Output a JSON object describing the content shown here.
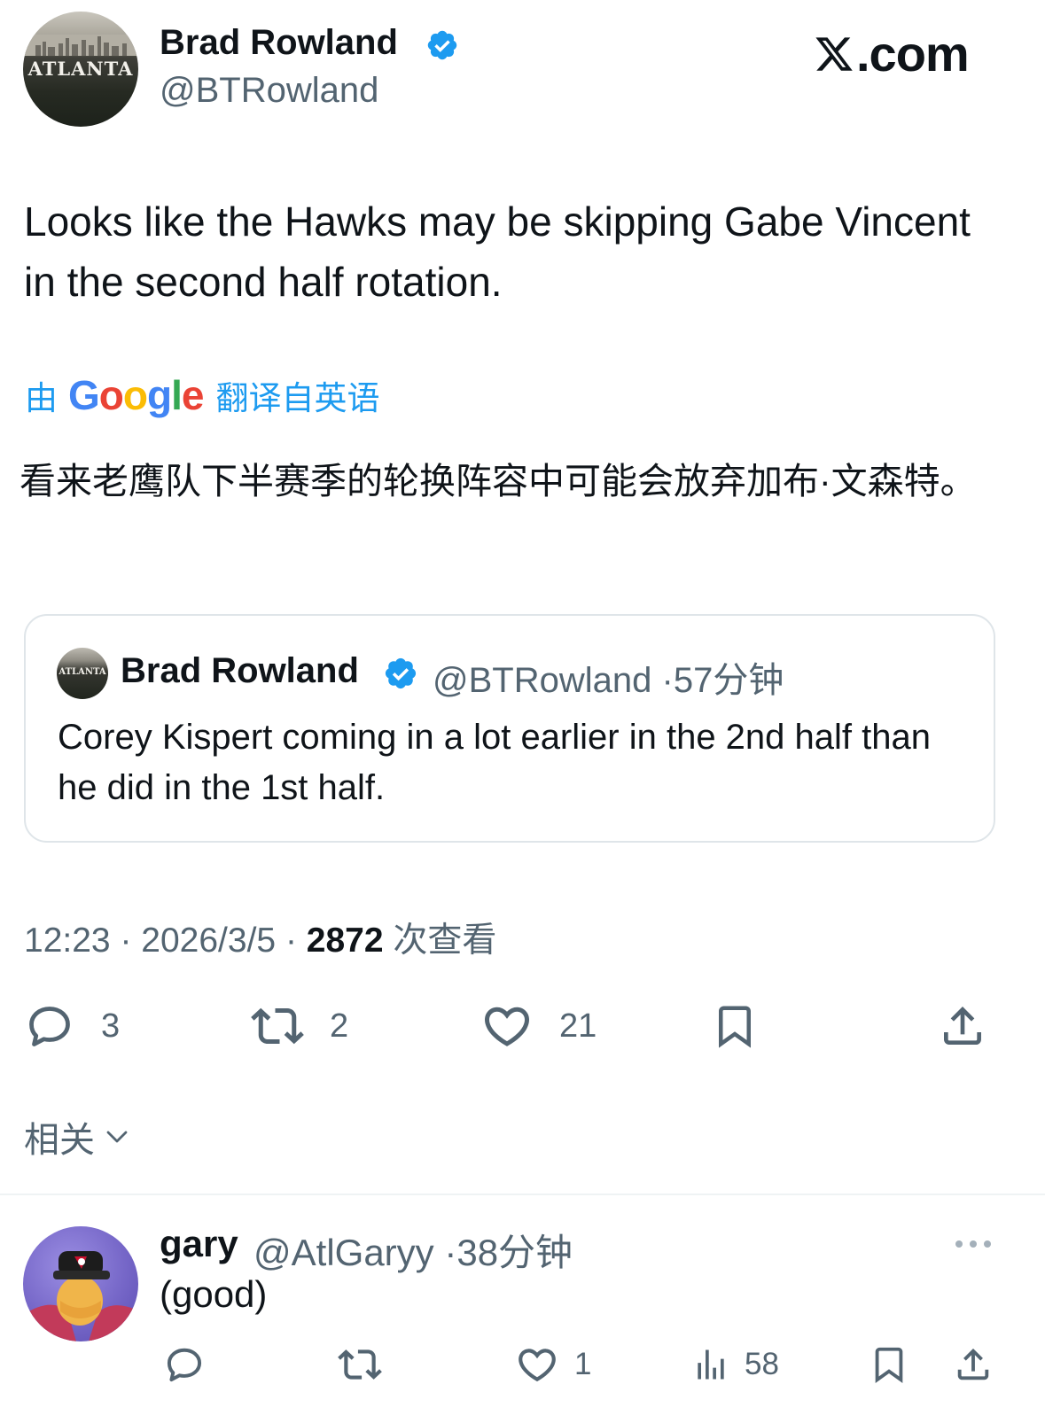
{
  "header": {
    "author_name": "Brad Rowland",
    "author_handle": "@BTRowland",
    "avatar_text": "ATLANTA",
    "site": ".com"
  },
  "tweet": {
    "text": "Looks like the Hawks may be skipping Gabe Vincent in the second half rotation.",
    "translate_prefix": "由",
    "translate_brand": "Google",
    "translate_suffix": "翻译自英语",
    "translated_text": "看来老鹰队下半赛季的轮换阵容中可能会放弃加布·文森特。"
  },
  "quote": {
    "author_name": "Brad Rowland",
    "author_handle": "@BTRowland",
    "time": "57分钟",
    "avatar_text": "ATLANTA",
    "text": "Corey Kispert coming in a lot earlier in the 2nd half than he did in the 1st half."
  },
  "meta": {
    "time": "12:23",
    "date": "2026/3/5",
    "views": "2872",
    "views_label": "次查看",
    "separator": "·"
  },
  "actions": {
    "replies": "3",
    "retweets": "2",
    "likes": "21"
  },
  "related_label": "相关",
  "reply": {
    "author_name": "gary",
    "author_handle": "@AtlGaryy",
    "time": "38分钟",
    "text": "(good)",
    "likes": "1",
    "views": "58"
  },
  "colors": {
    "accent": "#1d9bf0",
    "text": "#0f1419",
    "secondary": "#536471",
    "border": "#dfe5e9"
  },
  "icons": [
    "verified-badge-icon",
    "x-logo-icon",
    "reply-icon",
    "retweet-icon",
    "like-icon",
    "bookmark-icon",
    "share-icon",
    "chevron-down-icon",
    "views-icon",
    "more-icon"
  ]
}
